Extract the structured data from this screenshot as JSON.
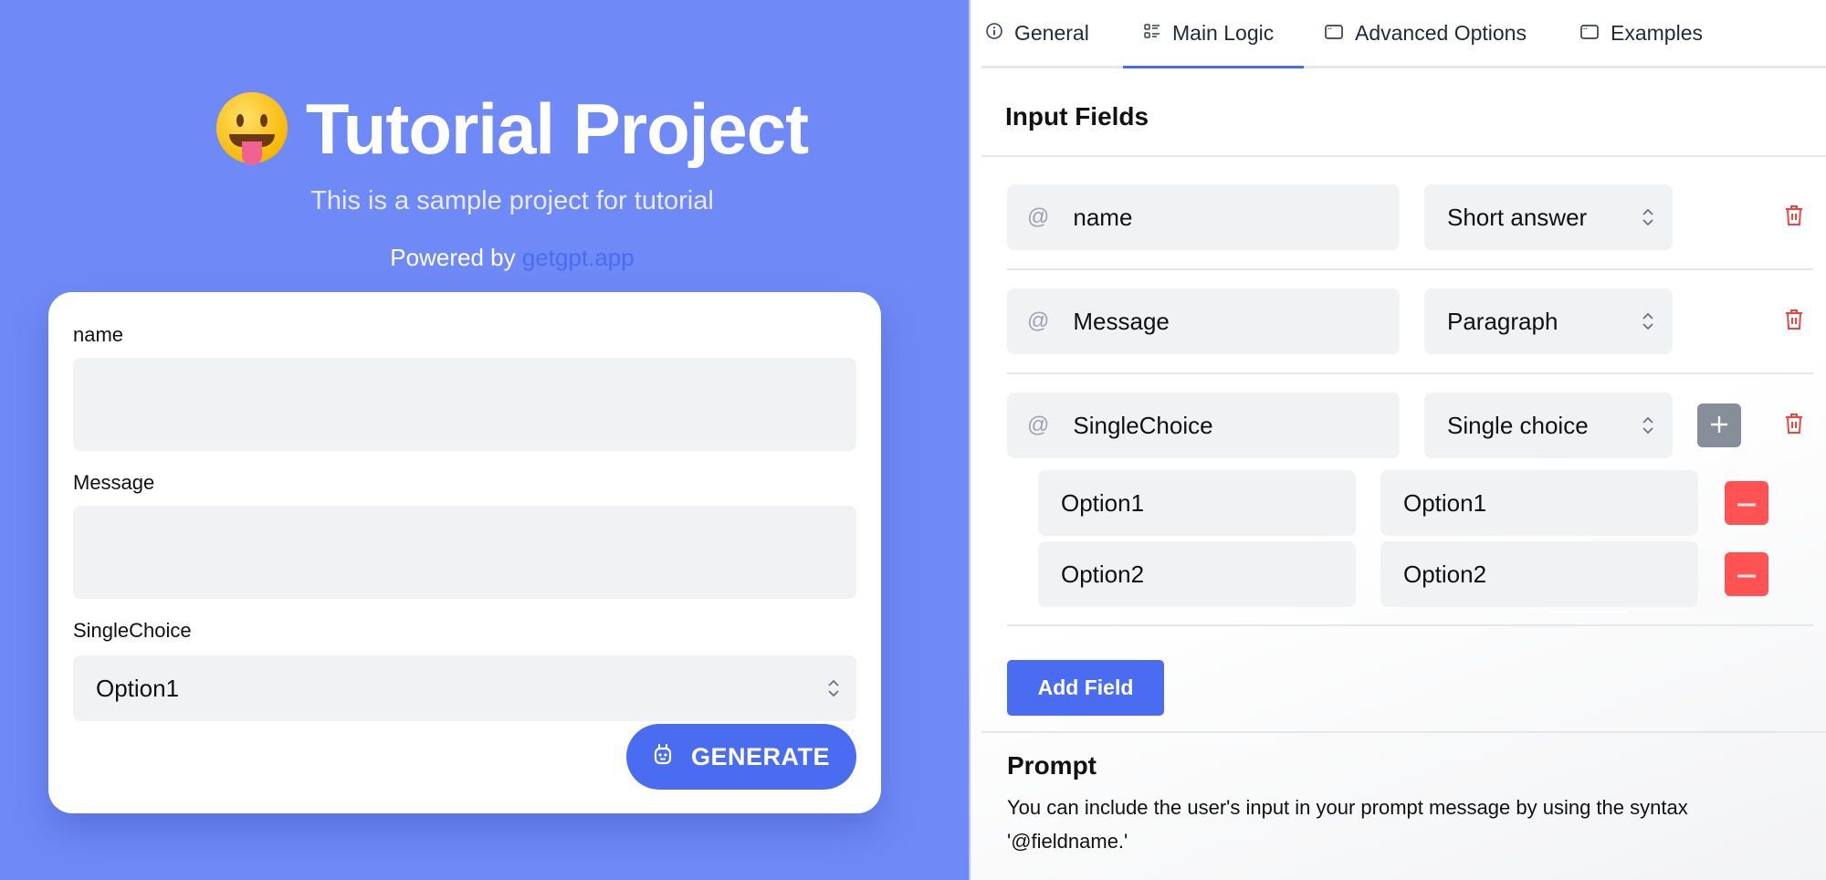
{
  "preview": {
    "title": "Tutorial Project",
    "emoji_icon": "face-with-tongue",
    "subtitle": "This is a sample project for tutorial",
    "powered_by_prefix": "Powered by",
    "powered_by_link": "getgpt.app",
    "form": {
      "fields": [
        {
          "label": "name",
          "value": ""
        },
        {
          "label": "Message",
          "value": ""
        },
        {
          "label": "SingleChoice",
          "selected": "Option1"
        }
      ],
      "generate_label": "GENERATE",
      "generate_icon": "robot-icon"
    }
  },
  "editor": {
    "tabs": [
      {
        "label": "General",
        "icon": "info-circle-icon",
        "active": false
      },
      {
        "label": "Main Logic",
        "icon": "list-icon",
        "active": true
      },
      {
        "label": "Advanced Options",
        "icon": "window-icon",
        "active": false
      },
      {
        "label": "Examples",
        "icon": "window-icon",
        "active": false
      }
    ],
    "input_fields_title": "Input Fields",
    "fields": [
      {
        "name": "name",
        "type": "Short answer"
      },
      {
        "name": "Message",
        "type": "Paragraph"
      },
      {
        "name": "SingleChoice",
        "type": "Single choice",
        "options": [
          {
            "label": "Option1",
            "value": "Option1"
          },
          {
            "label": "Option2",
            "value": "Option2"
          }
        ]
      }
    ],
    "field_prefix": "@",
    "add_field_label": "Add Field",
    "prompt_title": "Prompt",
    "prompt_description": "You can include the user's input in your prompt message by using the syntax '@fieldname.'"
  },
  "colors": {
    "background": "#6f8af7",
    "accent": "#4a6cf0",
    "danger": "#ff5252",
    "neutral_button": "#868e99",
    "input_bg": "#f1f2f4"
  }
}
